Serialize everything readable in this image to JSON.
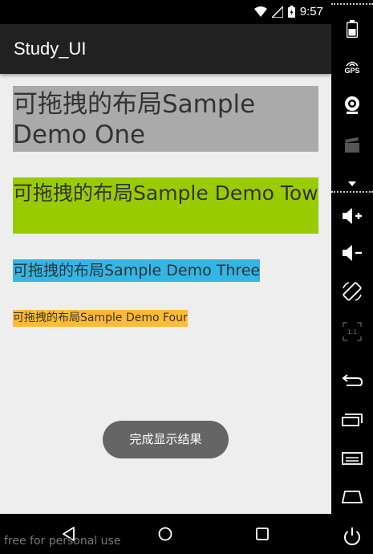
{
  "status_bar": {
    "time": "9:57"
  },
  "app_bar": {
    "title": "Study_UI"
  },
  "draggables": [
    {
      "text": "可拖拽的布局Sample Demo One",
      "color": "#aaaaaa"
    },
    {
      "text": "可拖拽的布局Sample Demo Tow",
      "color": "#99cc00"
    },
    {
      "text": "可拖拽的布局Sample Demo Three",
      "color": "#33b5e5"
    },
    {
      "text": "可拖拽的布局Sample Demo Four",
      "color": "#ffbb33"
    }
  ],
  "toast": {
    "text": "完成显示结果"
  },
  "watermark": {
    "text": "free for personal use"
  },
  "side_panel": {
    "gps_label": "GPS",
    "ratio_label": "1:1"
  }
}
